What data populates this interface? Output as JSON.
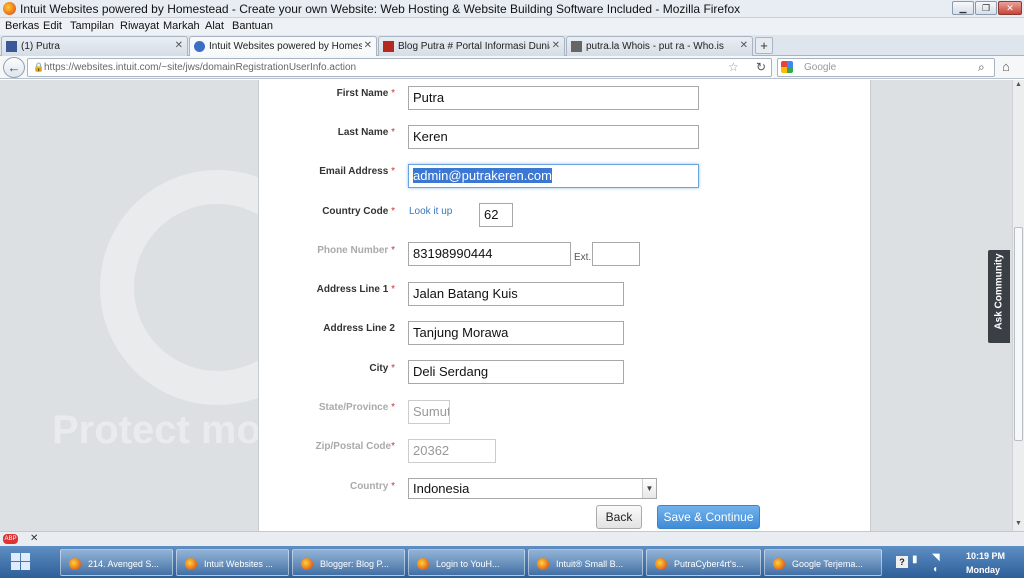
{
  "window": {
    "title": "Intuit Websites powered by Homestead - Create your own Website: Web Hosting & Website Building Software Included - Mozilla Firefox",
    "min": "▁",
    "max": "❐",
    "close": "✕"
  },
  "menu": [
    "Berkas",
    "Edit",
    "Tampilan",
    "Riwayat",
    "Markah",
    "Alat",
    "Bantuan"
  ],
  "tabs": [
    {
      "label": "(1) Putra",
      "icon": "facebook-icon",
      "color": "#3b5998"
    },
    {
      "label": "Intuit Websites powered by Homeste...",
      "icon": "globe-icon",
      "color": "#3b6fc4"
    },
    {
      "label": "Blog Putra # Portal Informasi Dunia ...",
      "icon": "blogger-icon",
      "color": "#b52a1e"
    },
    {
      "label": "putra.la Whois - put ra - Who.is",
      "icon": "whois-icon",
      "color": "#666666"
    }
  ],
  "tab_close": "✕",
  "new_tab": "+",
  "nav": {
    "back": "←",
    "url": "https://websites.intuit.com/~site/jws/domainRegistrationUserInfo.action",
    "lock": "🔒",
    "star": "☆",
    "reload": "↻",
    "search_placeholder": "Google",
    "search_icon": "⌕",
    "home": "⌂"
  },
  "watermark": "Protect mo",
  "form": {
    "first_name": {
      "label": "First Name",
      "value": "Putra"
    },
    "last_name": {
      "label": "Last Name",
      "value": "Keren"
    },
    "email": {
      "label": "Email Address",
      "value": "admin@putrakeren.com"
    },
    "country_code": {
      "label": "Country Code",
      "link": "Look it up",
      "value": "62"
    },
    "phone": {
      "label": "Phone Number",
      "value": "83198990444",
      "ext_label": "Ext.",
      "ext_value": ""
    },
    "address1": {
      "label": "Address Line 1",
      "value": "Jalan Batang Kuis"
    },
    "address2": {
      "label": "Address Line 2",
      "value": "Tanjung Morawa"
    },
    "city": {
      "label": "City",
      "value": "Deli Serdang"
    },
    "state": {
      "label": "State/Province",
      "value": "Sumut"
    },
    "zip": {
      "label": "Zip/Postal Code",
      "value": "20362"
    },
    "country": {
      "label": "Country",
      "value": "Indonesia"
    },
    "required_mark": "*",
    "back_label": "Back",
    "continue_label": "Save & Continue"
  },
  "ask_community": "Ask Community",
  "scroll": {
    "up": "▲",
    "down": "▼"
  },
  "addon": {
    "abp": "ABP",
    "close": "✕"
  },
  "taskbar": {
    "items": [
      "214. Avenged S...",
      "Intuit Websites ...",
      "Blogger: Blog P...",
      "Login to YouH...",
      "Intuit® Small B...",
      "PutraCyber4rt's...",
      "Google Terjema..."
    ],
    "tray": {
      "help": "?",
      "time": "10:19 PM",
      "day": "Monday"
    }
  }
}
